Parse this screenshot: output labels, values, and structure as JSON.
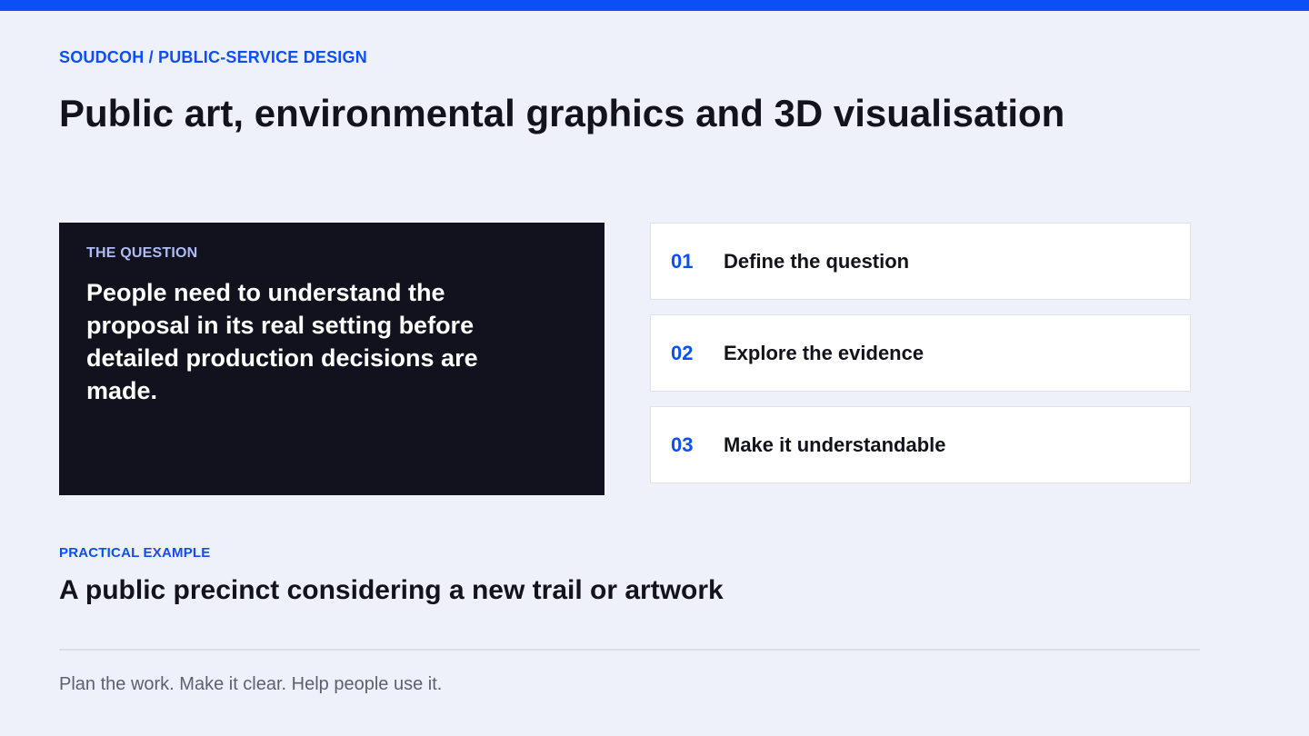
{
  "colors": {
    "accent": "#0b4ff5",
    "background": "#eef1f9",
    "dark_card": "#12121e",
    "text": "#12131c",
    "muted": "#5c6170"
  },
  "header": {
    "eyebrow": "SOUDCOH / PUBLIC-SERVICE DESIGN",
    "title": "Public art, environmental graphics and 3D visualisation"
  },
  "question": {
    "label": "THE QUESTION",
    "text": "People need to understand the proposal in its real setting before detailed production decisions are made."
  },
  "steps": [
    {
      "number": "01",
      "label": "Define the question"
    },
    {
      "number": "02",
      "label": "Explore the evidence"
    },
    {
      "number": "03",
      "label": "Make it understandable"
    }
  ],
  "example": {
    "eyebrow": "PRACTICAL EXAMPLE",
    "title": "A public precinct considering a new trail or artwork"
  },
  "footer": {
    "text": "Plan the work. Make it clear. Help people use it."
  }
}
